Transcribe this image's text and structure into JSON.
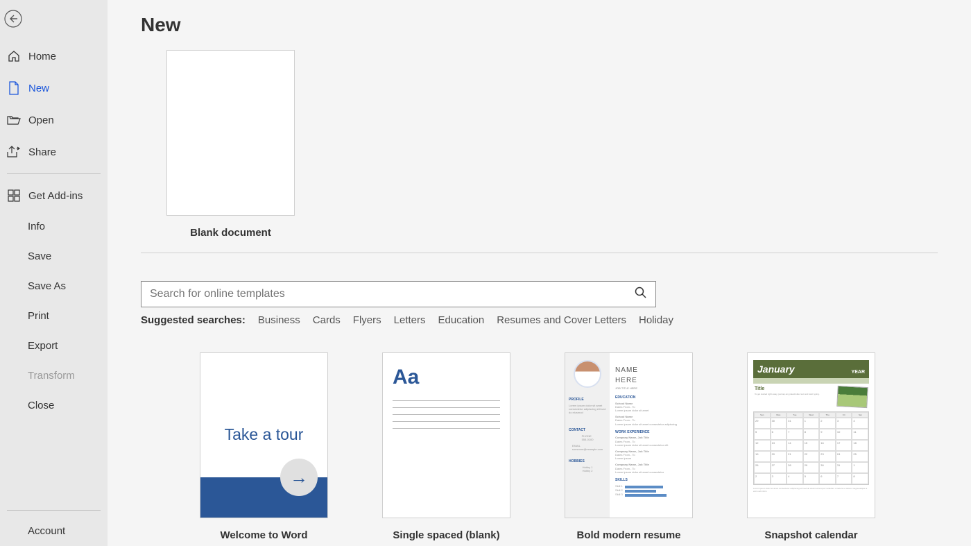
{
  "sidebar": {
    "items": [
      {
        "label": "Home"
      },
      {
        "label": "New"
      },
      {
        "label": "Open"
      },
      {
        "label": "Share"
      },
      {
        "label": "Get Add-ins"
      },
      {
        "label": "Info"
      },
      {
        "label": "Save"
      },
      {
        "label": "Save As"
      },
      {
        "label": "Print"
      },
      {
        "label": "Export"
      },
      {
        "label": "Transform"
      },
      {
        "label": "Close"
      }
    ],
    "bottom": {
      "account": "Account"
    }
  },
  "main": {
    "title": "New",
    "blank_label": "Blank document",
    "search": {
      "placeholder": "Search for online templates"
    },
    "suggested_label": "Suggested searches:",
    "suggested": [
      "Business",
      "Cards",
      "Flyers",
      "Letters",
      "Education",
      "Resumes and Cover Letters",
      "Holiday"
    ],
    "templates": [
      {
        "label": "Welcome to Word"
      },
      {
        "label": "Single spaced (blank)"
      },
      {
        "label": "Bold modern resume"
      },
      {
        "label": "Snapshot calendar"
      }
    ],
    "tour_text": "Take a tour",
    "single_aa": "Aa",
    "resume_name1": "NAME",
    "resume_name2": "HERE",
    "resume_sub": "JOB TITLE HERE",
    "cal_month": "January",
    "cal_year": "YEAR",
    "cal_title": "Title"
  }
}
